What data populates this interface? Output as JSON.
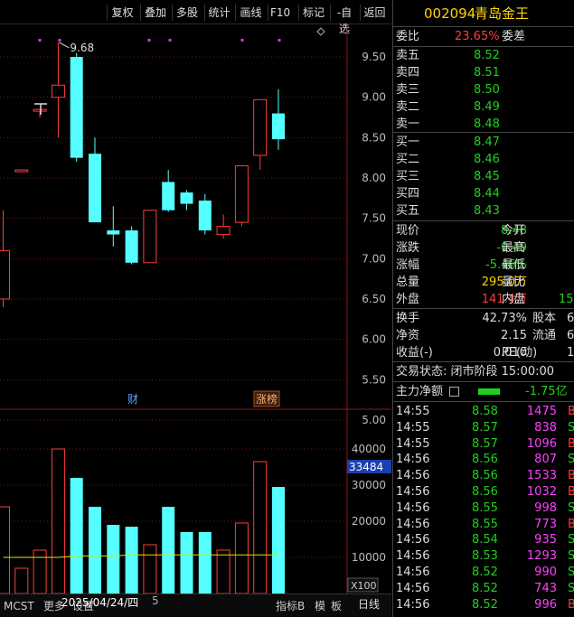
{
  "toolbar": {
    "buttons": [
      "复权",
      "叠加",
      "多股",
      "统计",
      "画线",
      "F10",
      "标记",
      "-自选",
      "返回"
    ]
  },
  "stock": {
    "code": "002094",
    "name": "青岛金王"
  },
  "chart": {
    "price_axis": [
      "9.50",
      "9.00",
      "8.50",
      "8.00",
      "7.50",
      "7.00",
      "6.50",
      "6.00",
      "5.50",
      "5.00"
    ],
    "high_marker": "9.68",
    "badge_cai": "财",
    "badge_zhangbang": "涨榜",
    "vol_axis": [
      "40000",
      "30000",
      "20000",
      "10000"
    ],
    "vol_cursor": "33484",
    "vol_unit": "X100",
    "date_cursor": "2025/04/24/四",
    "date_next": "5",
    "period": "日线",
    "candles": [
      {
        "o": 7.1,
        "c": 6.5,
        "h": 7.6,
        "l": 6.4,
        "up": true
      },
      {
        "o": 8.1,
        "c": 8.1,
        "h": 8.1,
        "l": 8.1,
        "up": true
      },
      {
        "o": 8.85,
        "c": 8.85,
        "h": 8.85,
        "l": 8.75,
        "up": true
      },
      {
        "o": 9.0,
        "c": 9.15,
        "h": 9.68,
        "l": 8.5,
        "up": true
      },
      {
        "o": 9.5,
        "c": 8.25,
        "h": 9.55,
        "l": 8.2,
        "up": false
      },
      {
        "o": 8.3,
        "c": 7.45,
        "h": 8.5,
        "l": 7.45,
        "up": false
      },
      {
        "o": 7.35,
        "c": 7.3,
        "h": 7.65,
        "l": 7.15,
        "up": false
      },
      {
        "o": 7.35,
        "c": 6.95,
        "h": 7.4,
        "l": 6.93,
        "up": false
      },
      {
        "o": 6.95,
        "c": 7.6,
        "h": 7.6,
        "l": 6.95,
        "up": true
      },
      {
        "o": 7.95,
        "c": 7.6,
        "h": 8.1,
        "l": 7.58,
        "up": false
      },
      {
        "o": 7.82,
        "c": 7.68,
        "h": 7.85,
        "l": 7.6,
        "up": false
      },
      {
        "o": 7.72,
        "c": 7.35,
        "h": 7.8,
        "l": 7.3,
        "up": false
      },
      {
        "o": 7.3,
        "c": 7.4,
        "h": 7.55,
        "l": 7.25,
        "up": true
      },
      {
        "o": 7.45,
        "c": 8.15,
        "h": 8.15,
        "l": 7.4,
        "up": true
      },
      {
        "o": 8.28,
        "c": 8.97,
        "h": 8.97,
        "l": 8.1,
        "up": true
      },
      {
        "o": 8.8,
        "c": 8.48,
        "h": 9.1,
        "l": 8.35,
        "up": false
      }
    ],
    "volumes": [
      {
        "v": 24000,
        "up": true
      },
      {
        "v": 7000,
        "up": true
      },
      {
        "v": 12000,
        "up": true
      },
      {
        "v": 40000,
        "up": true
      },
      {
        "v": 32000,
        "up": false
      },
      {
        "v": 24000,
        "up": false
      },
      {
        "v": 19000,
        "up": false
      },
      {
        "v": 18500,
        "up": false
      },
      {
        "v": 13500,
        "up": true
      },
      {
        "v": 24000,
        "up": false
      },
      {
        "v": 17000,
        "up": false
      },
      {
        "v": 17000,
        "up": false
      },
      {
        "v": 12000,
        "up": true
      },
      {
        "v": 19500,
        "up": true
      },
      {
        "v": 36500,
        "up": true
      },
      {
        "v": 29500,
        "up": false
      }
    ]
  },
  "quote": {
    "weibi_label": "委比",
    "weibi_value": "23.65%",
    "weicha_label": "委差",
    "asks": [
      {
        "label": "卖五",
        "price": "8.52"
      },
      {
        "label": "卖四",
        "price": "8.51"
      },
      {
        "label": "卖三",
        "price": "8.50"
      },
      {
        "label": "卖二",
        "price": "8.49"
      },
      {
        "label": "卖一",
        "price": "8.48"
      }
    ],
    "bids": [
      {
        "label": "买一",
        "price": "8.47"
      },
      {
        "label": "买二",
        "price": "8.46"
      },
      {
        "label": "买三",
        "price": "8.45"
      },
      {
        "label": "买四",
        "price": "8.44"
      },
      {
        "label": "买五",
        "price": "8.43"
      }
    ],
    "stats": [
      {
        "l1": "现价",
        "v1": "8.48",
        "c1": "green",
        "l2": "今开",
        "v2": ""
      },
      {
        "l1": "涨跌",
        "v1": "-0.49",
        "c1": "green",
        "l2": "最高",
        "v2": ""
      },
      {
        "l1": "涨幅",
        "v1": "-5.46%",
        "c1": "green",
        "l2": "最低",
        "v2": ""
      },
      {
        "l1": "总量",
        "v1": "295.0万",
        "c1": "yellow",
        "l2": "量比",
        "v2": ""
      },
      {
        "l1": "外盘",
        "v1": "141.4万",
        "c1": "red",
        "l2": "内盘",
        "v2": "15"
      }
    ],
    "stats2": [
      {
        "l1": "换手",
        "v1": "42.73%",
        "l2": "股本",
        "v2": "6"
      },
      {
        "l1": "净资",
        "v1": "2.15",
        "l2": "流通",
        "v2": "6"
      },
      {
        "l1": "收益(-)",
        "v1": "0.010",
        "l2": "PE(动)",
        "v2": "1"
      }
    ],
    "trade_status": "交易状态: 闭市阶段 15:00:00",
    "main_flow_label": "主力净额",
    "main_flow_value": "-1.75亿"
  },
  "ticks": [
    {
      "t": "14:55",
      "p": "8.58",
      "v": "1475",
      "s": "B"
    },
    {
      "t": "14:55",
      "p": "8.57",
      "v": "838",
      "s": "S"
    },
    {
      "t": "14:55",
      "p": "8.57",
      "v": "1096",
      "s": "B"
    },
    {
      "t": "14:56",
      "p": "8.56",
      "v": "807",
      "s": "S"
    },
    {
      "t": "14:56",
      "p": "8.56",
      "v": "1533",
      "s": "B"
    },
    {
      "t": "14:56",
      "p": "8.56",
      "v": "1032",
      "s": "B"
    },
    {
      "t": "14:56",
      "p": "8.55",
      "v": "998",
      "s": "S"
    },
    {
      "t": "14:56",
      "p": "8.55",
      "v": "773",
      "s": "B"
    },
    {
      "t": "14:56",
      "p": "8.54",
      "v": "935",
      "s": "S"
    },
    {
      "t": "14:56",
      "p": "8.53",
      "v": "1293",
      "s": "S"
    },
    {
      "t": "14:56",
      "p": "8.52",
      "v": "990",
      "s": "S"
    },
    {
      "t": "14:56",
      "p": "8.52",
      "v": "743",
      "s": "S"
    },
    {
      "t": "14:56",
      "p": "8.52",
      "v": "996",
      "s": "B"
    }
  ],
  "bottom": {
    "tabs": [
      "MCST",
      "更多",
      "设置"
    ],
    "right_tabs": [
      "指标B",
      "模",
      "板"
    ]
  },
  "colors": {
    "up": "#ff3b3b",
    "down": "#55ffff",
    "grid": "#7a1010",
    "ma": "#e8e000"
  }
}
